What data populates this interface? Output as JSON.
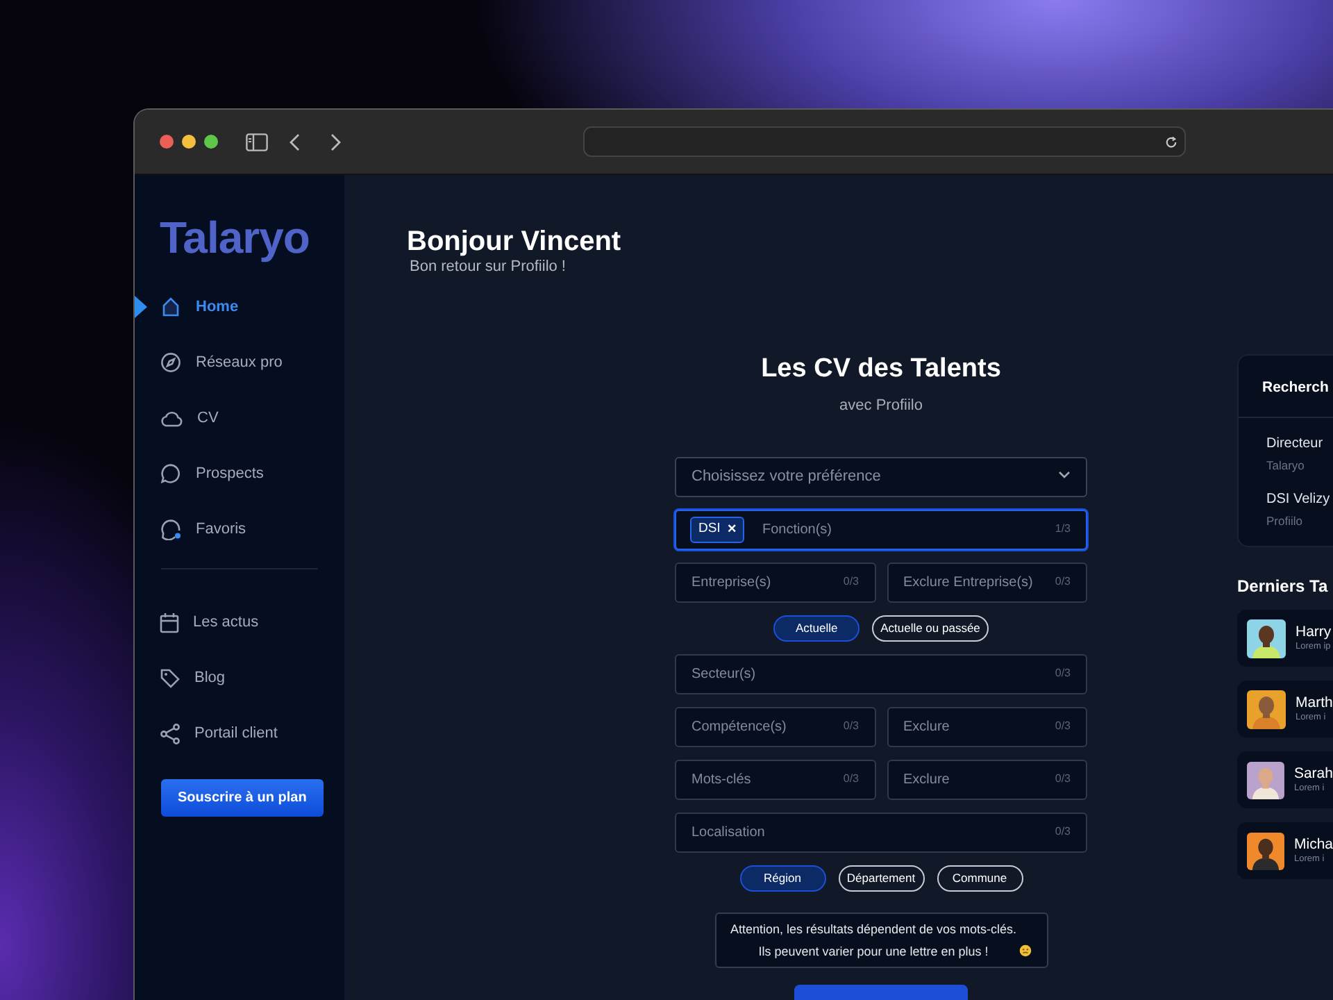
{
  "sidebar": {
    "logo": "Talaryo",
    "items": [
      {
        "label": "Home",
        "selected": true
      },
      {
        "label": "Réseaux pro",
        "selected": false
      },
      {
        "label": "CV",
        "selected": false
      },
      {
        "label": "Prospects",
        "selected": false
      },
      {
        "label": "Favoris",
        "selected": false
      }
    ],
    "secondary_items": [
      {
        "label": "Les actus"
      },
      {
        "label": "Blog"
      },
      {
        "label": "Portail client"
      }
    ],
    "subscribe_button": "Souscrire à un plan"
  },
  "header": {
    "title": "Bonjour Vincent",
    "subtitle": "Bon retour sur Profiilo !"
  },
  "search": {
    "title": "Les CV des Talents",
    "subtitle": "avec Profiilo",
    "rows": [
      {
        "kind": "select",
        "placeholder": "Choisissez votre préférence"
      },
      {
        "kind": "fields",
        "fields": [
          {
            "placeholder": "Fonction(s)",
            "count": "1/3",
            "focused": true,
            "tags": [
              {
                "label": "DSI",
                "remove": "×"
              }
            ]
          }
        ]
      },
      {
        "kind": "fields",
        "fields": [
          {
            "placeholder": "Entreprise(s)",
            "count": "0/3",
            "focused": false
          },
          {
            "placeholder": "Exclure Entreprise(s)",
            "count": "0/3",
            "focused": false
          }
        ]
      },
      {
        "kind": "toggles",
        "options": [
          {
            "label": "Actuelle",
            "selected": true
          },
          {
            "label": "Actuelle ou passée",
            "selected": false
          }
        ]
      },
      {
        "kind": "fields",
        "fields": [
          {
            "placeholder": "Secteur(s)",
            "count": "0/3",
            "focused": false
          }
        ]
      },
      {
        "kind": "fields",
        "fields": [
          {
            "placeholder": "Compétence(s)",
            "count": "0/3",
            "focused": false
          },
          {
            "placeholder": "Exclure",
            "count": "0/3",
            "focused": false
          }
        ]
      },
      {
        "kind": "fields",
        "fields": [
          {
            "placeholder": "Mots-clés",
            "count": "0/3",
            "focused": false
          },
          {
            "placeholder": "Exclure",
            "count": "0/3",
            "focused": false
          }
        ]
      },
      {
        "kind": "fields",
        "fields": [
          {
            "placeholder": "Localisation",
            "count": "0/3",
            "focused": false
          }
        ]
      },
      {
        "kind": "toggles",
        "options": [
          {
            "label": "Région",
            "selected": true
          },
          {
            "label": "Département",
            "selected": false
          },
          {
            "label": "Commune",
            "selected": false
          }
        ]
      }
    ],
    "notice": {
      "lines": [
        "Attention, les résultats dépendent de vos mots-clés.",
        "Ils peuvent varier pour une lettre en plus !"
      ]
    }
  },
  "saved_searches": {
    "title": "Recherch",
    "items": [
      {
        "title": "Directeur",
        "subtitle": "Talaryo"
      },
      {
        "title": "DSI Velizy",
        "subtitle": "Profiilo"
      }
    ]
  },
  "recent_talents": {
    "title": "Derniers Ta",
    "items": [
      {
        "name": "Harry",
        "snippet": "Lorem ip"
      },
      {
        "name": "Marth",
        "snippet": "Lorem i"
      },
      {
        "name": "Sarah",
        "snippet": "Lorem i"
      },
      {
        "name": "Micha",
        "snippet": "Lorem i"
      }
    ]
  }
}
